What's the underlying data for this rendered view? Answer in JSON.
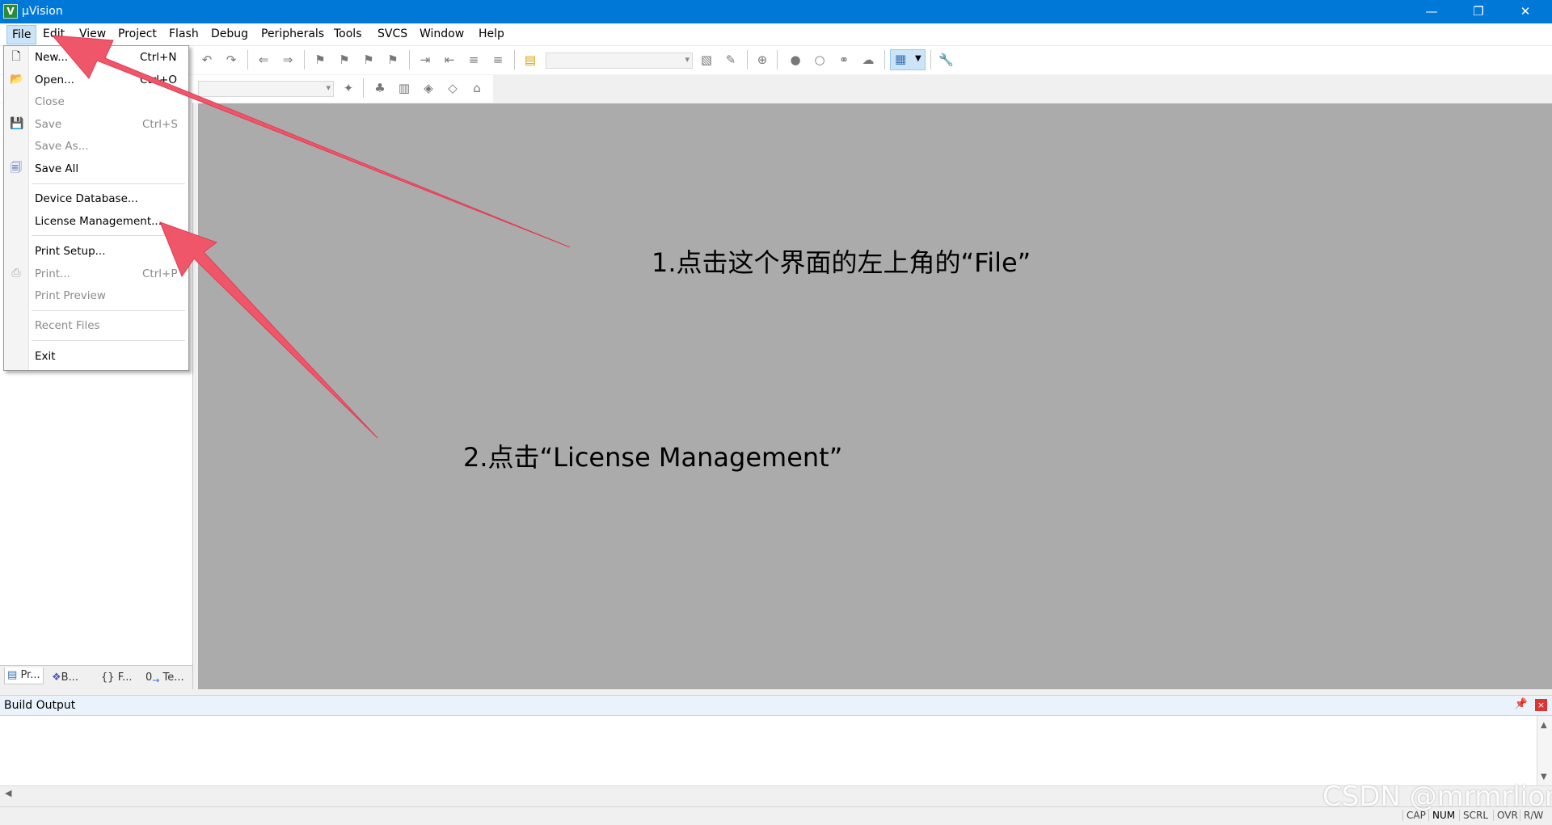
{
  "window": {
    "title": "µVision",
    "minimize_glyph": "—",
    "maximize_glyph": "❐",
    "close_glyph": "✕"
  },
  "menubar": {
    "items": [
      "File",
      "Edit",
      "View",
      "Project",
      "Flash",
      "Debug",
      "Peripherals",
      "Tools",
      "SVCS",
      "Window",
      "Help"
    ]
  },
  "file_menu": {
    "items": [
      {
        "label": "New...",
        "shortcut": "Ctrl+N",
        "enabled": true,
        "icon": "new-file-icon"
      },
      {
        "label": "Open...",
        "shortcut": "Ctrl+O",
        "enabled": true,
        "icon": "open-folder-icon"
      },
      {
        "label": "Close",
        "shortcut": "",
        "enabled": false,
        "icon": ""
      },
      {
        "label": "Save",
        "shortcut": "Ctrl+S",
        "enabled": false,
        "icon": "save-icon"
      },
      {
        "label": "Save As...",
        "shortcut": "",
        "enabled": false,
        "icon": ""
      },
      {
        "label": "Save All",
        "shortcut": "",
        "enabled": true,
        "icon": "save-all-icon"
      },
      {
        "label": "Device Database...",
        "shortcut": "",
        "enabled": true,
        "icon": ""
      },
      {
        "label": "License Management...",
        "shortcut": "",
        "enabled": true,
        "icon": ""
      },
      {
        "label": "Print Setup...",
        "shortcut": "",
        "enabled": true,
        "icon": ""
      },
      {
        "label": "Print...",
        "shortcut": "Ctrl+P",
        "enabled": false,
        "icon": "print-icon"
      },
      {
        "label": "Print Preview",
        "shortcut": "",
        "enabled": false,
        "icon": ""
      },
      {
        "label": "Recent Files",
        "shortcut": "",
        "enabled": false,
        "icon": ""
      },
      {
        "label": "Exit",
        "shortcut": "",
        "enabled": true,
        "icon": ""
      }
    ]
  },
  "left_panel": {
    "tabs": [
      "Pr...",
      "B...",
      "F...",
      "Te..."
    ]
  },
  "build_output": {
    "title": "Build Output",
    "pin_glyph": "📌",
    "close_glyph": "×"
  },
  "statusbar": {
    "indicators": [
      "CAP",
      "NUM",
      "SCRL",
      "OVR",
      "R/W"
    ],
    "active": [
      "NUM"
    ]
  },
  "annotations": {
    "step1": "1.点击这个界面的左上角的“File”",
    "step2": "2.点击“License Management”"
  },
  "watermark": "CSDN @mrmrlion",
  "colors": {
    "titlebar": "#0078d7",
    "workspace": "#ababab",
    "arrow": "#f0566a",
    "menu_highlight": "#cce4f7"
  }
}
